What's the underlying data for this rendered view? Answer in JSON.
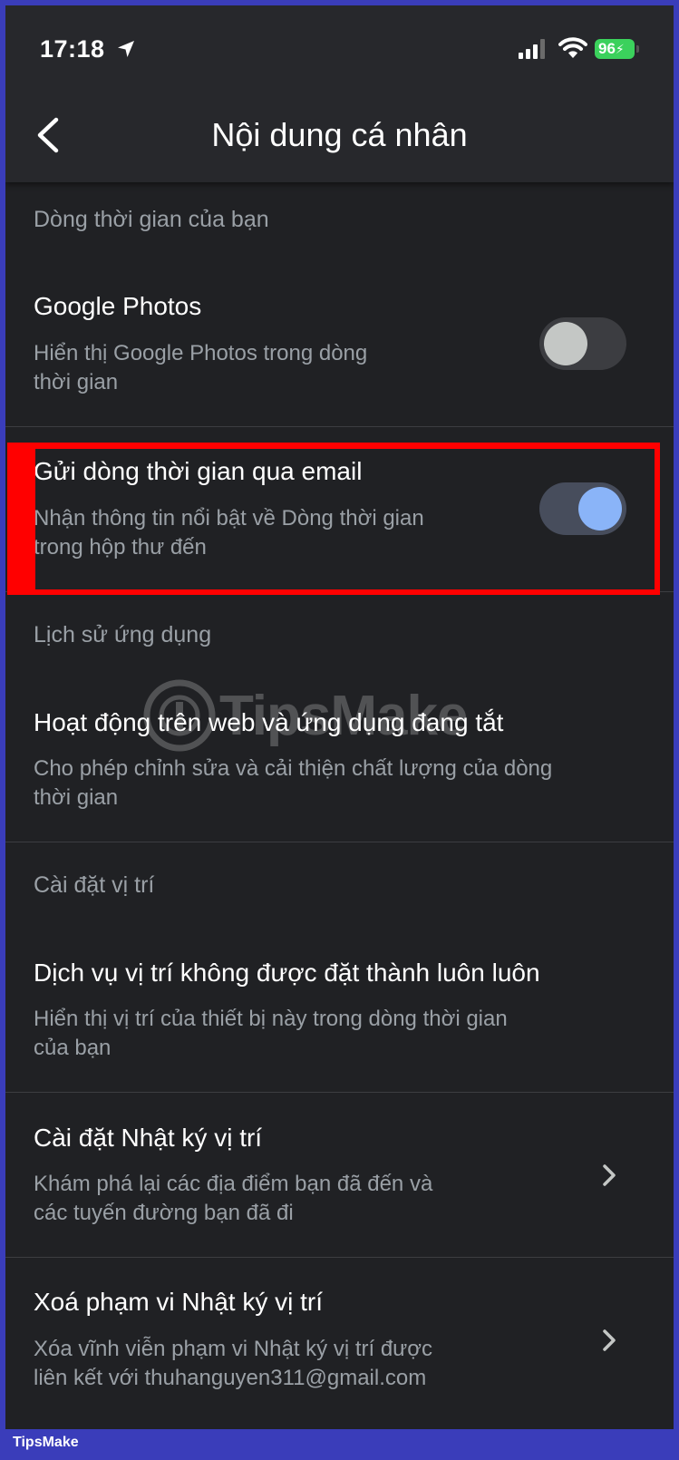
{
  "status_bar": {
    "time": "17:18",
    "battery": "96"
  },
  "header": {
    "title": "Nội dung cá nhân"
  },
  "sections": {
    "timeline": {
      "heading": "Dòng thời gian của bạn",
      "google_photos": {
        "title": "Google Photos",
        "desc_line1": "Hiển thị Google Photos trong dòng",
        "desc_line2": "thời gian",
        "toggle_on": false
      },
      "email_timeline": {
        "title": "Gửi dòng thời gian qua email",
        "desc_line1": "Nhận thông tin nổi bật về Dòng thời gian",
        "desc_line2": "trong hộp thư đến",
        "toggle_on": true
      }
    },
    "app_history": {
      "heading": "Lịch sử ứng dụng",
      "web_activity": {
        "title": "Hoạt động trên web và ứng dụng đang tắt",
        "desc_line1": "Cho phép chỉnh sửa và cải thiện chất lượng của dòng",
        "desc_line2": "thời gian"
      }
    },
    "location": {
      "heading": "Cài đặt vị trí",
      "location_services": {
        "title": "Dịch vụ vị trí không được đặt thành luôn luôn",
        "desc_line1": "Hiển thị vị trí của thiết bị này trong dòng thời gian",
        "desc_line2": "của bạn"
      },
      "location_history_settings": {
        "title": "Cài đặt Nhật ký vị trí",
        "desc_line1": "Khám phá lại các địa điểm bạn đã đến và",
        "desc_line2": "các tuyến đường bạn đã đi"
      },
      "delete_location_history": {
        "title": "Xoá phạm vi Nhật ký vị trí",
        "desc_line1": "Xóa vĩnh viễn phạm vi Nhật ký vị trí được",
        "desc_line2": "liên kết với thuhanguyen311@gmail.com"
      }
    }
  },
  "watermark": "TipsMake",
  "footer_brand": "TipsMake",
  "colors": {
    "background": "#202124",
    "header": "#27282c",
    "primary_text": "#ffffff",
    "secondary_text": "#9aa0a6",
    "toggle_on_track": "#474d5c",
    "toggle_on_thumb": "#8ab4f8",
    "toggle_off_track": "#3c3d41",
    "toggle_off_thumb": "#c4c7c5",
    "highlight": "#ff0000",
    "frame": "#3a3dba"
  }
}
